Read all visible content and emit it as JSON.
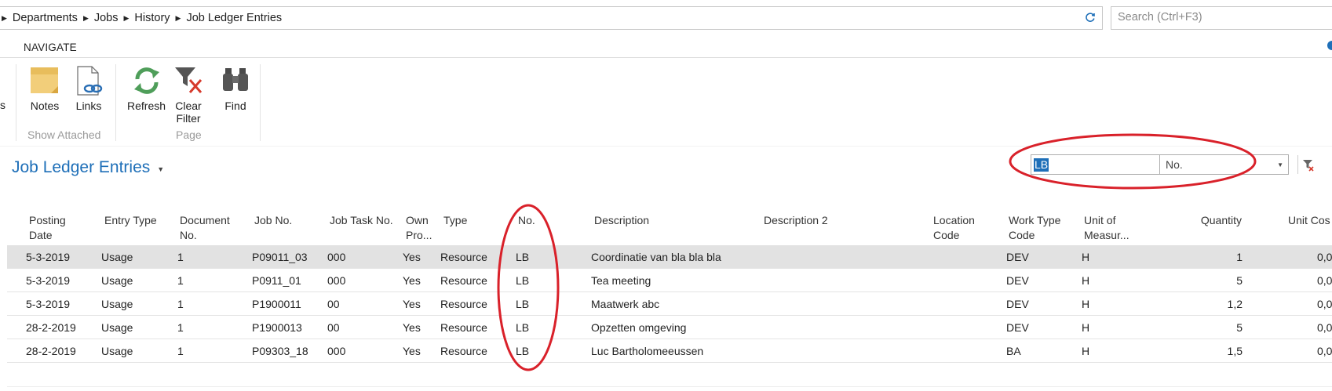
{
  "breadcrumb": {
    "items": [
      "Departments",
      "Jobs",
      "History",
      "Job Ledger Entries"
    ]
  },
  "search": {
    "placeholder": "Search (Ctrl+F3)"
  },
  "ribbon": {
    "tab": "NAVIGATE",
    "cut_label": "s",
    "buttons": {
      "notes": "Notes",
      "links": "Links",
      "refresh": "Refresh",
      "clear_filter_1": "Clear",
      "clear_filter_2": "Filter",
      "find": "Find"
    },
    "groups": {
      "show_attached": "Show Attached",
      "page": "Page"
    }
  },
  "page": {
    "title": "Job Ledger Entries"
  },
  "filter": {
    "value": "LB",
    "field": "No."
  },
  "table": {
    "headers": {
      "posting_date": [
        "Posting",
        "Date"
      ],
      "entry_type": [
        "Entry Type"
      ],
      "document_no": [
        "Document",
        "No."
      ],
      "job_no": [
        "Job No."
      ],
      "job_task_no": [
        "Job Task No."
      ],
      "own_pro": [
        "Own",
        "Pro..."
      ],
      "type": [
        "Type"
      ],
      "no": [
        "No."
      ],
      "description": [
        "Description"
      ],
      "description2": [
        "Description 2"
      ],
      "location_code": [
        "Location",
        "Code"
      ],
      "work_type_code": [
        "Work Type",
        "Code"
      ],
      "unit_of_measure": [
        "Unit of",
        "Measur..."
      ],
      "quantity": [
        "Quantity"
      ],
      "unit_cost": [
        "Unit Cos"
      ]
    },
    "rows": [
      {
        "posting_date": "5-3-2019",
        "entry_type": "Usage",
        "document_no": "1",
        "job_no": "P09011_03",
        "job_task_no": "000",
        "own_pro": "Yes",
        "type": "Resource",
        "no": "LB",
        "description": "Coordinatie van bla bla bla",
        "work_type_code": "DEV",
        "unit": "H",
        "quantity": "1",
        "unit_cost": "0,0"
      },
      {
        "posting_date": "5-3-2019",
        "entry_type": "Usage",
        "document_no": "1",
        "job_no": "P0911_01",
        "job_task_no": "000",
        "own_pro": "Yes",
        "type": "Resource",
        "no": "LB",
        "description": "Tea meeting",
        "work_type_code": "DEV",
        "unit": "H",
        "quantity": "5",
        "unit_cost": "0,0"
      },
      {
        "posting_date": "5-3-2019",
        "entry_type": "Usage",
        "document_no": "1",
        "job_no": "P1900011",
        "job_task_no": "00",
        "own_pro": "Yes",
        "type": "Resource",
        "no": "LB",
        "description": "Maatwerk abc",
        "work_type_code": "DEV",
        "unit": "H",
        "quantity": "1,2",
        "unit_cost": "0,0"
      },
      {
        "posting_date": "28-2-2019",
        "entry_type": "Usage",
        "document_no": "1",
        "job_no": "P1900013",
        "job_task_no": "00",
        "own_pro": "Yes",
        "type": "Resource",
        "no": "LB",
        "description": "Opzetten omgeving",
        "work_type_code": "DEV",
        "unit": "H",
        "quantity": "5",
        "unit_cost": "0,0"
      },
      {
        "posting_date": "28-2-2019",
        "entry_type": "Usage",
        "document_no": "1",
        "job_no": "P09303_18",
        "job_task_no": "000",
        "own_pro": "Yes",
        "type": "Resource",
        "no": "LB",
        "description": "Luc Bartholomeeussen",
        "work_type_code": "BA",
        "unit": "H",
        "quantity": "1,5",
        "unit_cost": "0,0"
      }
    ]
  },
  "colors": {
    "accent": "#1e6fb8",
    "annotation": "#d9212a",
    "selected_row": "#e2e2e2"
  }
}
